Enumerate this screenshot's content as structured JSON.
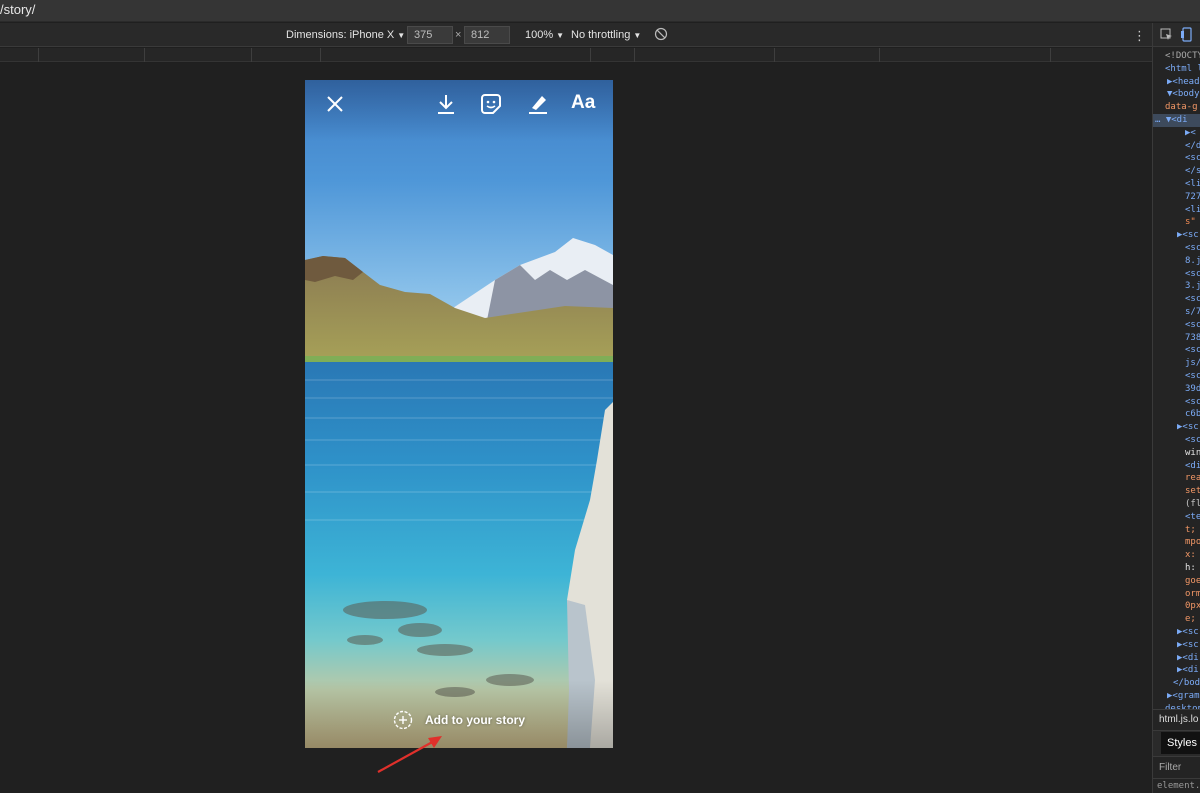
{
  "browser": {
    "url_text": "/story/"
  },
  "device_toolbar": {
    "dimensions_label": "Dimensions: iPhone X",
    "width_value": "375",
    "times_symbol": "×",
    "height_value": "812",
    "zoom_label": "100%",
    "throttling_label": "No throttling",
    "caret": "▼",
    "more_icon": "⋮"
  },
  "story": {
    "aa_label": "Aa",
    "add_to_story_label": "Add to your story",
    "icons": [
      "close-icon",
      "download-icon",
      "sticker-icon",
      "draw-icon",
      "text-icon",
      "add-circle-icon"
    ]
  },
  "devtools": {
    "code_lines": [
      {
        "indent": 12,
        "text": "<!DOCTY",
        "color": "#a9a9a9"
      },
      {
        "indent": 12,
        "text": "<html l",
        "color": "#7cacf8"
      },
      {
        "indent": 14,
        "text": "▶<head",
        "color": "#7cacf8"
      },
      {
        "indent": 14,
        "text": "▼<body",
        "color": "#7cacf8"
      },
      {
        "indent": 12,
        "text": "data-g",
        "color": "#f29766"
      },
      {
        "indent": 2,
        "text": "… ▼<di",
        "color": "#7cacf8"
      },
      {
        "indent": 32,
        "text": "▶<",
        "color": "#7cacf8"
      },
      {
        "indent": 32,
        "text": "</d",
        "color": "#7cacf8"
      },
      {
        "indent": 32,
        "text": "<sc",
        "color": "#7cacf8"
      },
      {
        "indent": 32,
        "text": "</s",
        "color": "#7cacf8"
      },
      {
        "indent": 32,
        "text": "<li",
        "color": "#7cacf8"
      },
      {
        "indent": 32,
        "text": "727",
        "color": "#7cacf8"
      },
      {
        "indent": 32,
        "text": "<li",
        "color": "#7cacf8"
      },
      {
        "indent": 32,
        "text": "s\"",
        "color": "#f28b54"
      },
      {
        "indent": 24,
        "text": "▶<sc",
        "color": "#7cacf8"
      },
      {
        "indent": 32,
        "text": "<sc",
        "color": "#7cacf8"
      },
      {
        "indent": 32,
        "text": "8.j",
        "color": "#7cacf8"
      },
      {
        "indent": 32,
        "text": "<sc",
        "color": "#7cacf8"
      },
      {
        "indent": 32,
        "text": "3.j",
        "color": "#7cacf8"
      },
      {
        "indent": 32,
        "text": "<sc",
        "color": "#7cacf8"
      },
      {
        "indent": 32,
        "text": "s/7",
        "color": "#7cacf8"
      },
      {
        "indent": 32,
        "text": "<sc",
        "color": "#7cacf8"
      },
      {
        "indent": 32,
        "text": "738",
        "color": "#7cacf8"
      },
      {
        "indent": 32,
        "text": "<sc",
        "color": "#7cacf8"
      },
      {
        "indent": 32,
        "text": "js/",
        "color": "#7cacf8"
      },
      {
        "indent": 32,
        "text": "<sc",
        "color": "#7cacf8"
      },
      {
        "indent": 32,
        "text": "39d",
        "color": "#7cacf8"
      },
      {
        "indent": 32,
        "text": "<sc",
        "color": "#7cacf8"
      },
      {
        "indent": 32,
        "text": "c6b",
        "color": "#7cacf8"
      },
      {
        "indent": 24,
        "text": "▶<sc",
        "color": "#7cacf8"
      },
      {
        "indent": 32,
        "text": "<sc",
        "color": "#7cacf8"
      },
      {
        "indent": 32,
        "text": "win",
        "color": "#e3e3e3"
      },
      {
        "indent": 32,
        "text": "<di",
        "color": "#7cacf8"
      },
      {
        "indent": 32,
        "text": "rea",
        "color": "#f29766"
      },
      {
        "indent": 32,
        "text": "set",
        "color": "#f29766"
      },
      {
        "indent": 32,
        "text": "(fl",
        "color": "#c8c8c8"
      },
      {
        "indent": 32,
        "text": "<te",
        "color": "#7cacf8"
      },
      {
        "indent": 32,
        "text": "t;",
        "color": "#f29766"
      },
      {
        "indent": 32,
        "text": "mpo",
        "color": "#f29766"
      },
      {
        "indent": 32,
        "text": "x:",
        "color": "#f29766"
      },
      {
        "indent": 32,
        "text": "h:",
        "color": "#e3e3e3"
      },
      {
        "indent": 32,
        "text": "goe",
        "color": "#f29766"
      },
      {
        "indent": 32,
        "text": "orm",
        "color": "#f29766"
      },
      {
        "indent": 32,
        "text": "0px",
        "color": "#f29766"
      },
      {
        "indent": 32,
        "text": "e;",
        "color": "#f29766"
      },
      {
        "indent": 24,
        "text": "▶<sc",
        "color": "#7cacf8"
      },
      {
        "indent": 24,
        "text": "▶<sc",
        "color": "#7cacf8"
      },
      {
        "indent": 24,
        "text": "▶<di",
        "color": "#7cacf8"
      },
      {
        "indent": 24,
        "text": "▶<di",
        "color": "#7cacf8"
      },
      {
        "indent": 20,
        "text": "</bod",
        "color": "#7cacf8"
      },
      {
        "indent": 14,
        "text": "▶<gram",
        "color": "#7cacf8"
      },
      {
        "indent": 12,
        "text": "desktop",
        "color": "#7cacf8"
      }
    ],
    "breadcrumb": "html.js.lo",
    "styles_tab": "Styles",
    "filter_placeholder": "Filter",
    "element_text": "element."
  }
}
